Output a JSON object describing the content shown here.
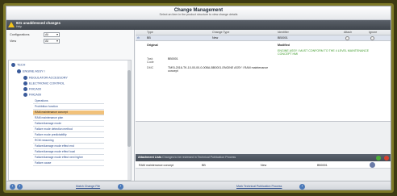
{
  "header": {
    "title": "Change Management",
    "subtitle": "Select an item in the product structure to view change details"
  },
  "banner": {
    "title": "821 unaddressed changes",
    "subtitle": "Help"
  },
  "filters": {
    "configurations_label": "Configurations",
    "configurations_value": "All",
    "view_label": "View",
    "view_value": "All"
  },
  "tree": {
    "root": "TECH",
    "level1": "ENGINE ASSY I",
    "level2": [
      "REGULATOR ACCESSORY",
      "ELECTRONIC CONTROL",
      "FMCA09",
      "FMCA09"
    ],
    "leaves": [
      "Operations",
      "Prohibition function",
      "RAM maintenance concept",
      "RAM maintenance plan",
      "Failure/damage mode",
      "Failure mode detection method",
      "Failure mode predictability",
      "RCM reasoning",
      "Failure/damage mode effect end",
      "Failure/damage mode effect local",
      "Failure/damage mode effect next higher",
      "Failure cause"
    ],
    "selected_index": 2
  },
  "changes_table": {
    "columns": [
      "Type",
      "Change Type",
      "Identifier",
      "Attach",
      "Ignore"
    ],
    "row": {
      "type": "BB",
      "change_type": "New",
      "identifier": "BB0001"
    }
  },
  "detail": {
    "original_label": "Original",
    "modified_label": "Modified",
    "modified_text": "ENGINE ASSY I MUST CONFORM TO THE 4 LEVEL MAINTENANCE CONCEPT HMI",
    "task_code_label": "Task Code",
    "task_code_value": "BB0001",
    "dmc_label": "DMC",
    "dmc_value": "TMSI-2016-TK-10-00-00-0-00BA-BB0001-ENGINE ASSY I RAM maintenance concept"
  },
  "attachments": {
    "title": "Attachment Lists",
    "subtitle": "Changes to be reviewed in Technical Publication Process",
    "row": {
      "name": "RAM maintenance concept",
      "type": "BB",
      "change": "New",
      "id": "BB0001"
    }
  },
  "footer": {
    "left_link": "Match Change File",
    "right_link": "Mark Technical Publication Process"
  },
  "colors": {
    "banner": "#4a5058",
    "selected_row": "#f1c17a",
    "tree_link": "#2a4a8a",
    "modified_text": "#3d9a2a",
    "frame": "#7f7a28"
  }
}
